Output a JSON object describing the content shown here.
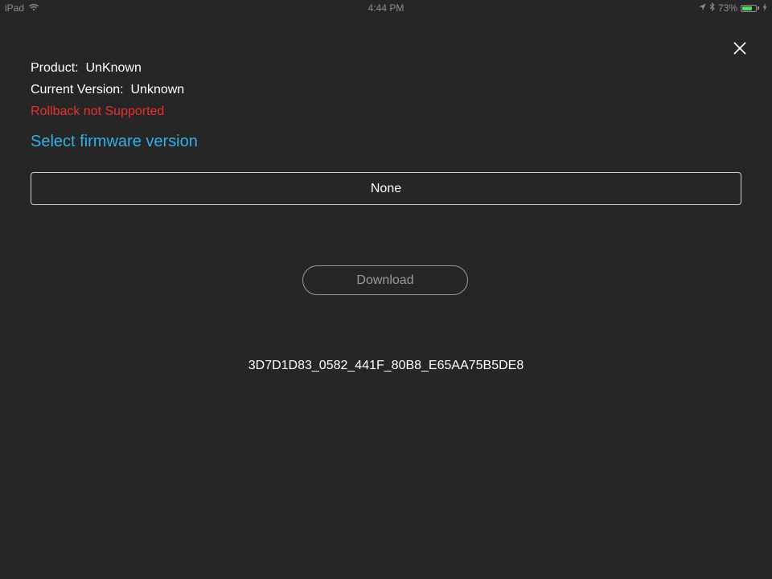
{
  "status_bar": {
    "device": "iPad",
    "time": "4:44 PM",
    "battery": "73%",
    "battery_level": 0.73
  },
  "info": {
    "product_label": "Product:",
    "product_value": "UnKnown",
    "version_label": "Current Version:",
    "version_value": "Unknown",
    "rollback_text": "Rollback not Supported"
  },
  "firmware": {
    "title": "Select firmware version",
    "selected": "None"
  },
  "actions": {
    "download_label": "Download"
  },
  "device_id": "3D7D1D83_0582_441F_80B8_E65AA75B5DE8",
  "colors": {
    "background": "#262626",
    "accent": "#2fb1e6",
    "error": "#e8302f",
    "battery": "#4cd964"
  },
  "icons": {
    "close": "close-icon",
    "wifi": "wifi-icon",
    "location": "location-arrow-icon",
    "bluetooth": "bluetooth-icon",
    "charging": "charging-bolt-icon"
  }
}
